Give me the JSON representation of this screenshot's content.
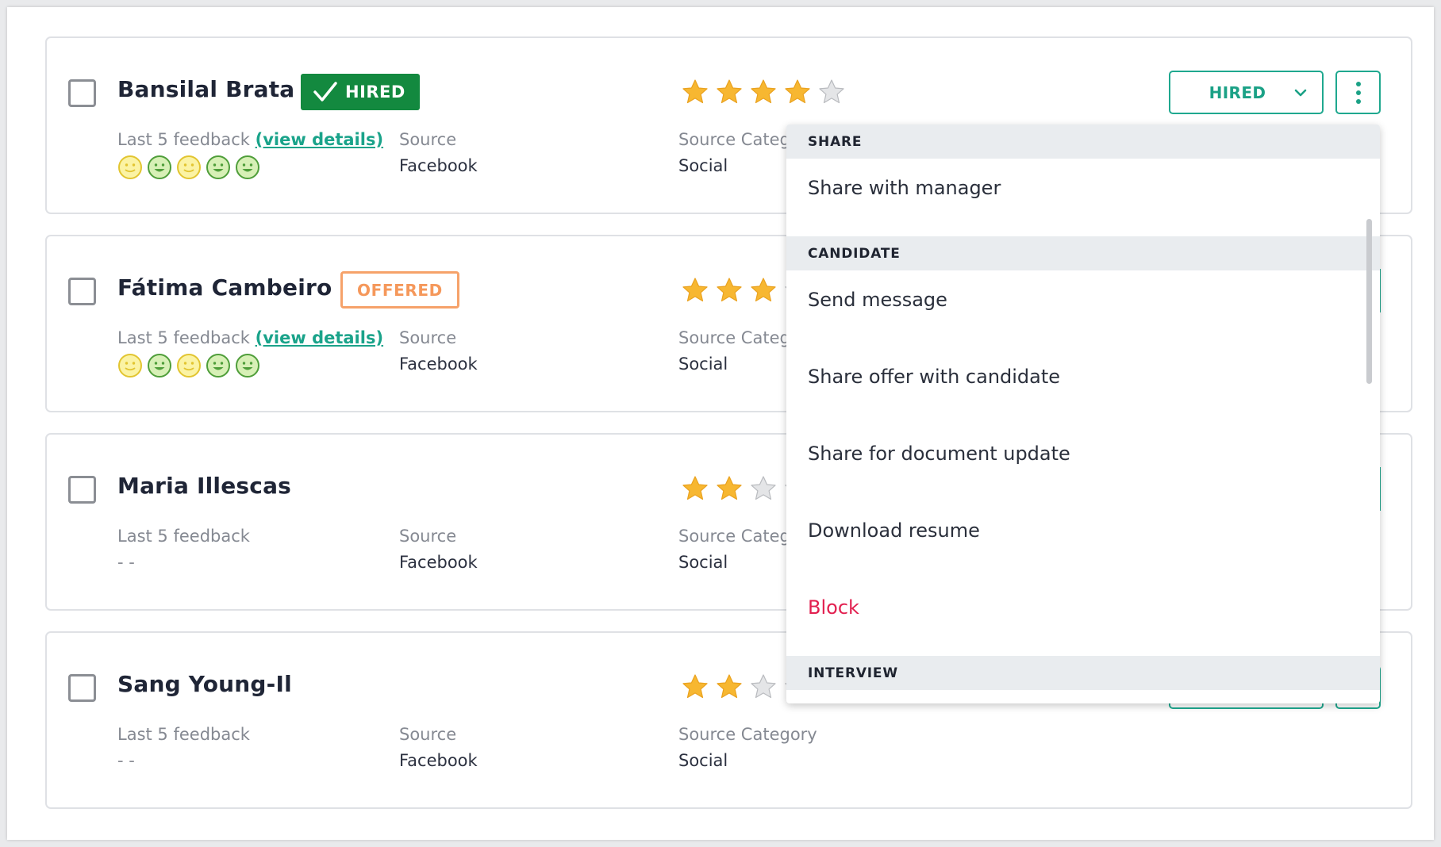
{
  "candidates": [
    {
      "name": "Bansilal Brata",
      "badge": "HIRED",
      "rating": 4,
      "feedback_label": "Last 5 feedback",
      "feedback_link": "(view details)",
      "feedback_faces": [
        "neutral",
        "happy",
        "neutral",
        "happy",
        "happy"
      ],
      "source_label": "Source",
      "source": "Facebook",
      "source_category_label": "Source Category",
      "source_category": "Social",
      "status": "HIRED"
    },
    {
      "name": "Fátima Cambeiro",
      "badge": "OFFERED",
      "rating": 3,
      "feedback_label": "Last 5 feedback",
      "feedback_link": "(view details)",
      "feedback_faces": [
        "neutral",
        "happy",
        "neutral",
        "happy",
        "happy"
      ],
      "source_label": "Source",
      "source": "Facebook",
      "source_category_label": "Source Category",
      "source_category": "Social"
    },
    {
      "name": "Maria Illescas",
      "rating": 2,
      "feedback_label": "Last 5 feedback",
      "feedback_empty": "- -",
      "source_label": "Source",
      "source": "Facebook",
      "source_category_label": "Source Category",
      "source_category": "Social"
    },
    {
      "name": "Sang Young-Il",
      "rating": 2,
      "feedback_label": "Last 5 feedback",
      "feedback_empty": "- -",
      "source_label": "Source",
      "source": "Facebook",
      "source_category_label": "Source Category",
      "source_category": "Social"
    }
  ],
  "menu": {
    "share_header": "SHARE",
    "share_with_manager": "Share with manager",
    "candidate_header": "CANDIDATE",
    "send_message": "Send message",
    "share_offer": "Share offer with candidate",
    "share_document": "Share for document update",
    "download_resume": "Download resume",
    "block": "Block",
    "interview_header": "INTERVIEW"
  },
  "colors": {
    "accent": "#1ba186",
    "hired_badge": "#13893f",
    "offered_badge": "#f5985b",
    "star_filled": "#f7b731",
    "danger": "#e21f4f"
  },
  "icons": {
    "checkbox": "checkbox-icon",
    "check": "check-icon",
    "star": "star-icon",
    "face_happy": "happy-face-icon",
    "face_neutral": "neutral-face-icon",
    "chevron": "chevron-down-icon",
    "more": "more-vertical-icon"
  }
}
